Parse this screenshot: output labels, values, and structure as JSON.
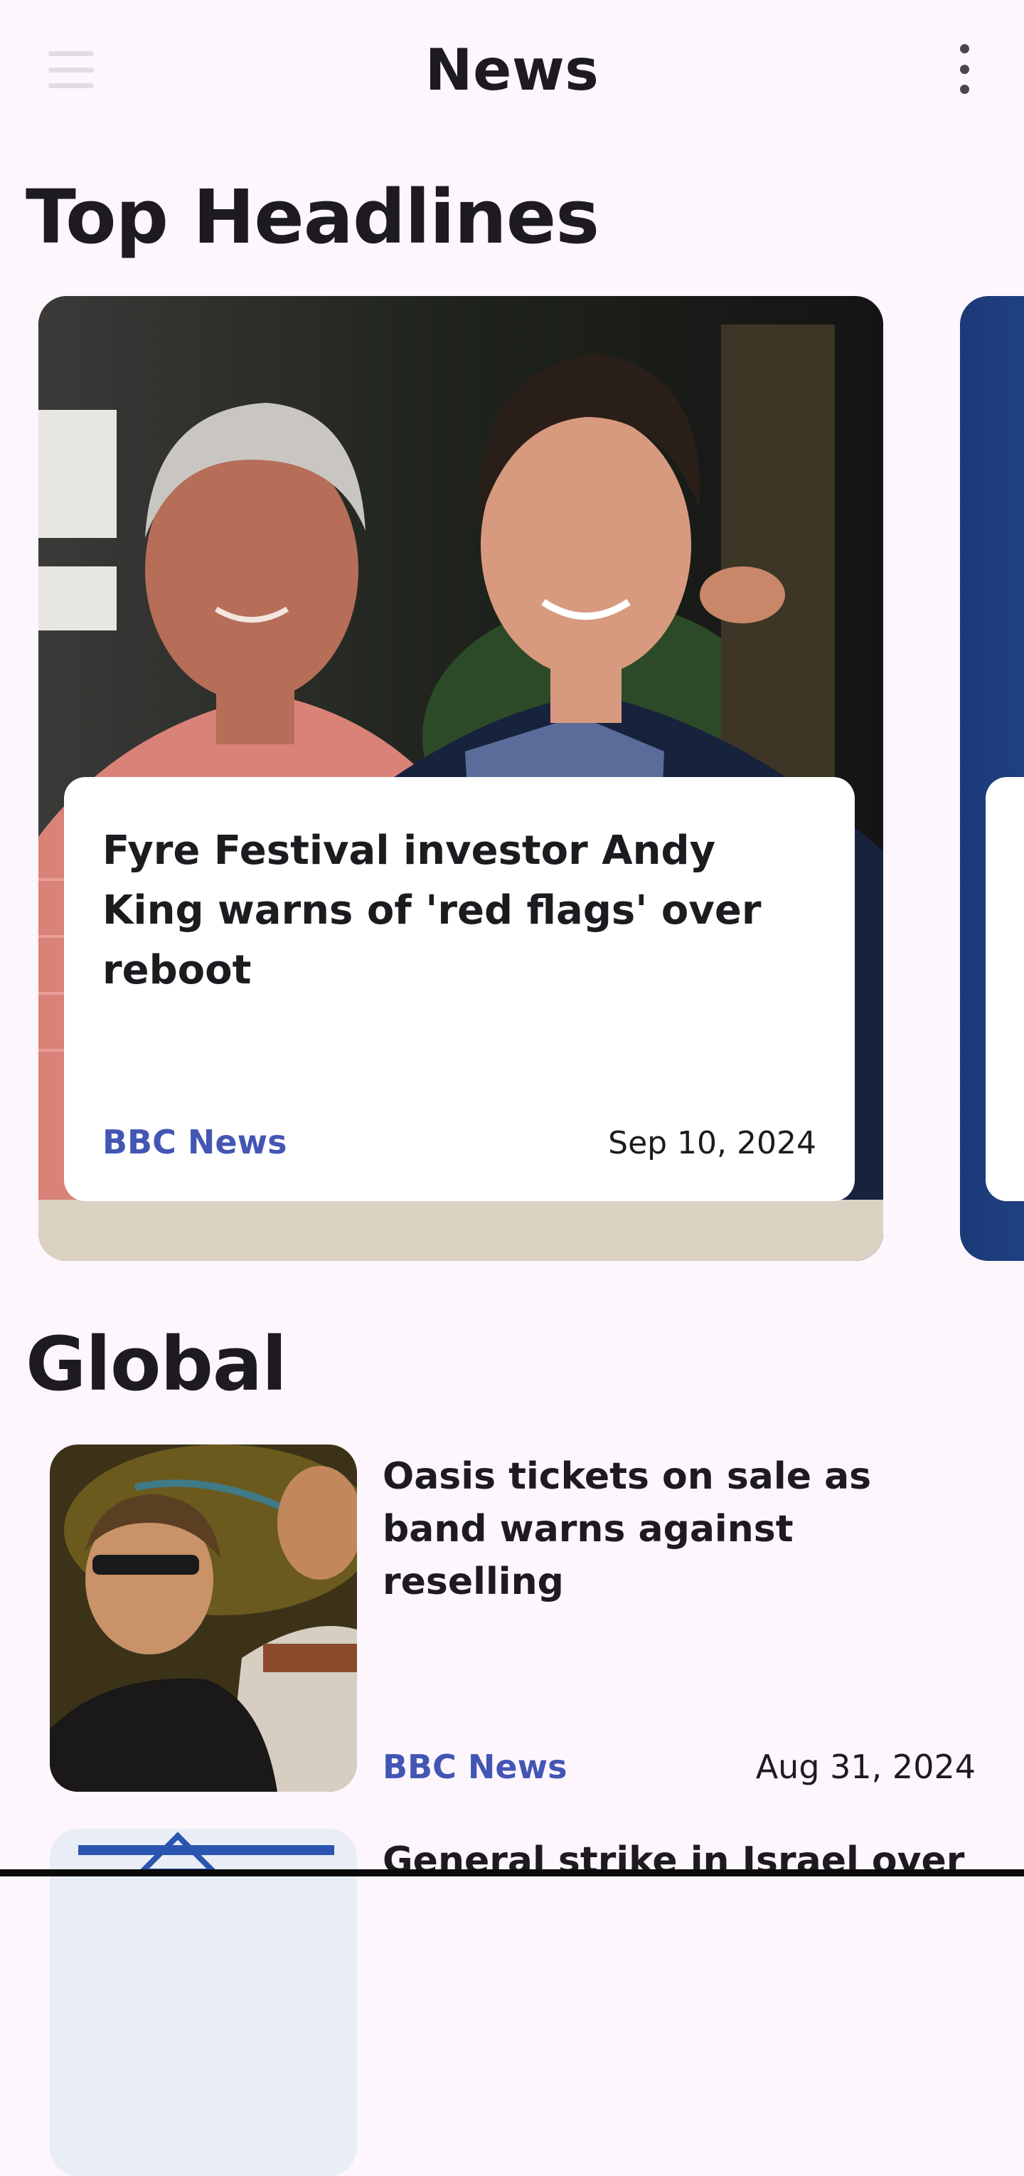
{
  "app_bar": {
    "title": "News",
    "menu_icon": "hamburger-menu-icon",
    "overflow_icon": "more-vertical-icon"
  },
  "top_headlines": {
    "section_title": "Top Headlines",
    "cards": [
      {
        "title": "Fyre Festival investor Andy King warns of 'red flags' over reboot",
        "source": "BBC News",
        "date": "Sep 10, 2024"
      }
    ]
  },
  "global": {
    "section_title": "Global",
    "items": [
      {
        "title": "Oasis tickets on sale as band warns against reselling",
        "source": "BBC News",
        "date": "Aug 31, 2024"
      },
      {
        "title": "General strike in Israel over"
      }
    ]
  },
  "colors": {
    "background": "#fdf6fd",
    "source_accent": "#4356b4",
    "card_surface": "#ffffff",
    "text_primary": "#1d1b20"
  }
}
